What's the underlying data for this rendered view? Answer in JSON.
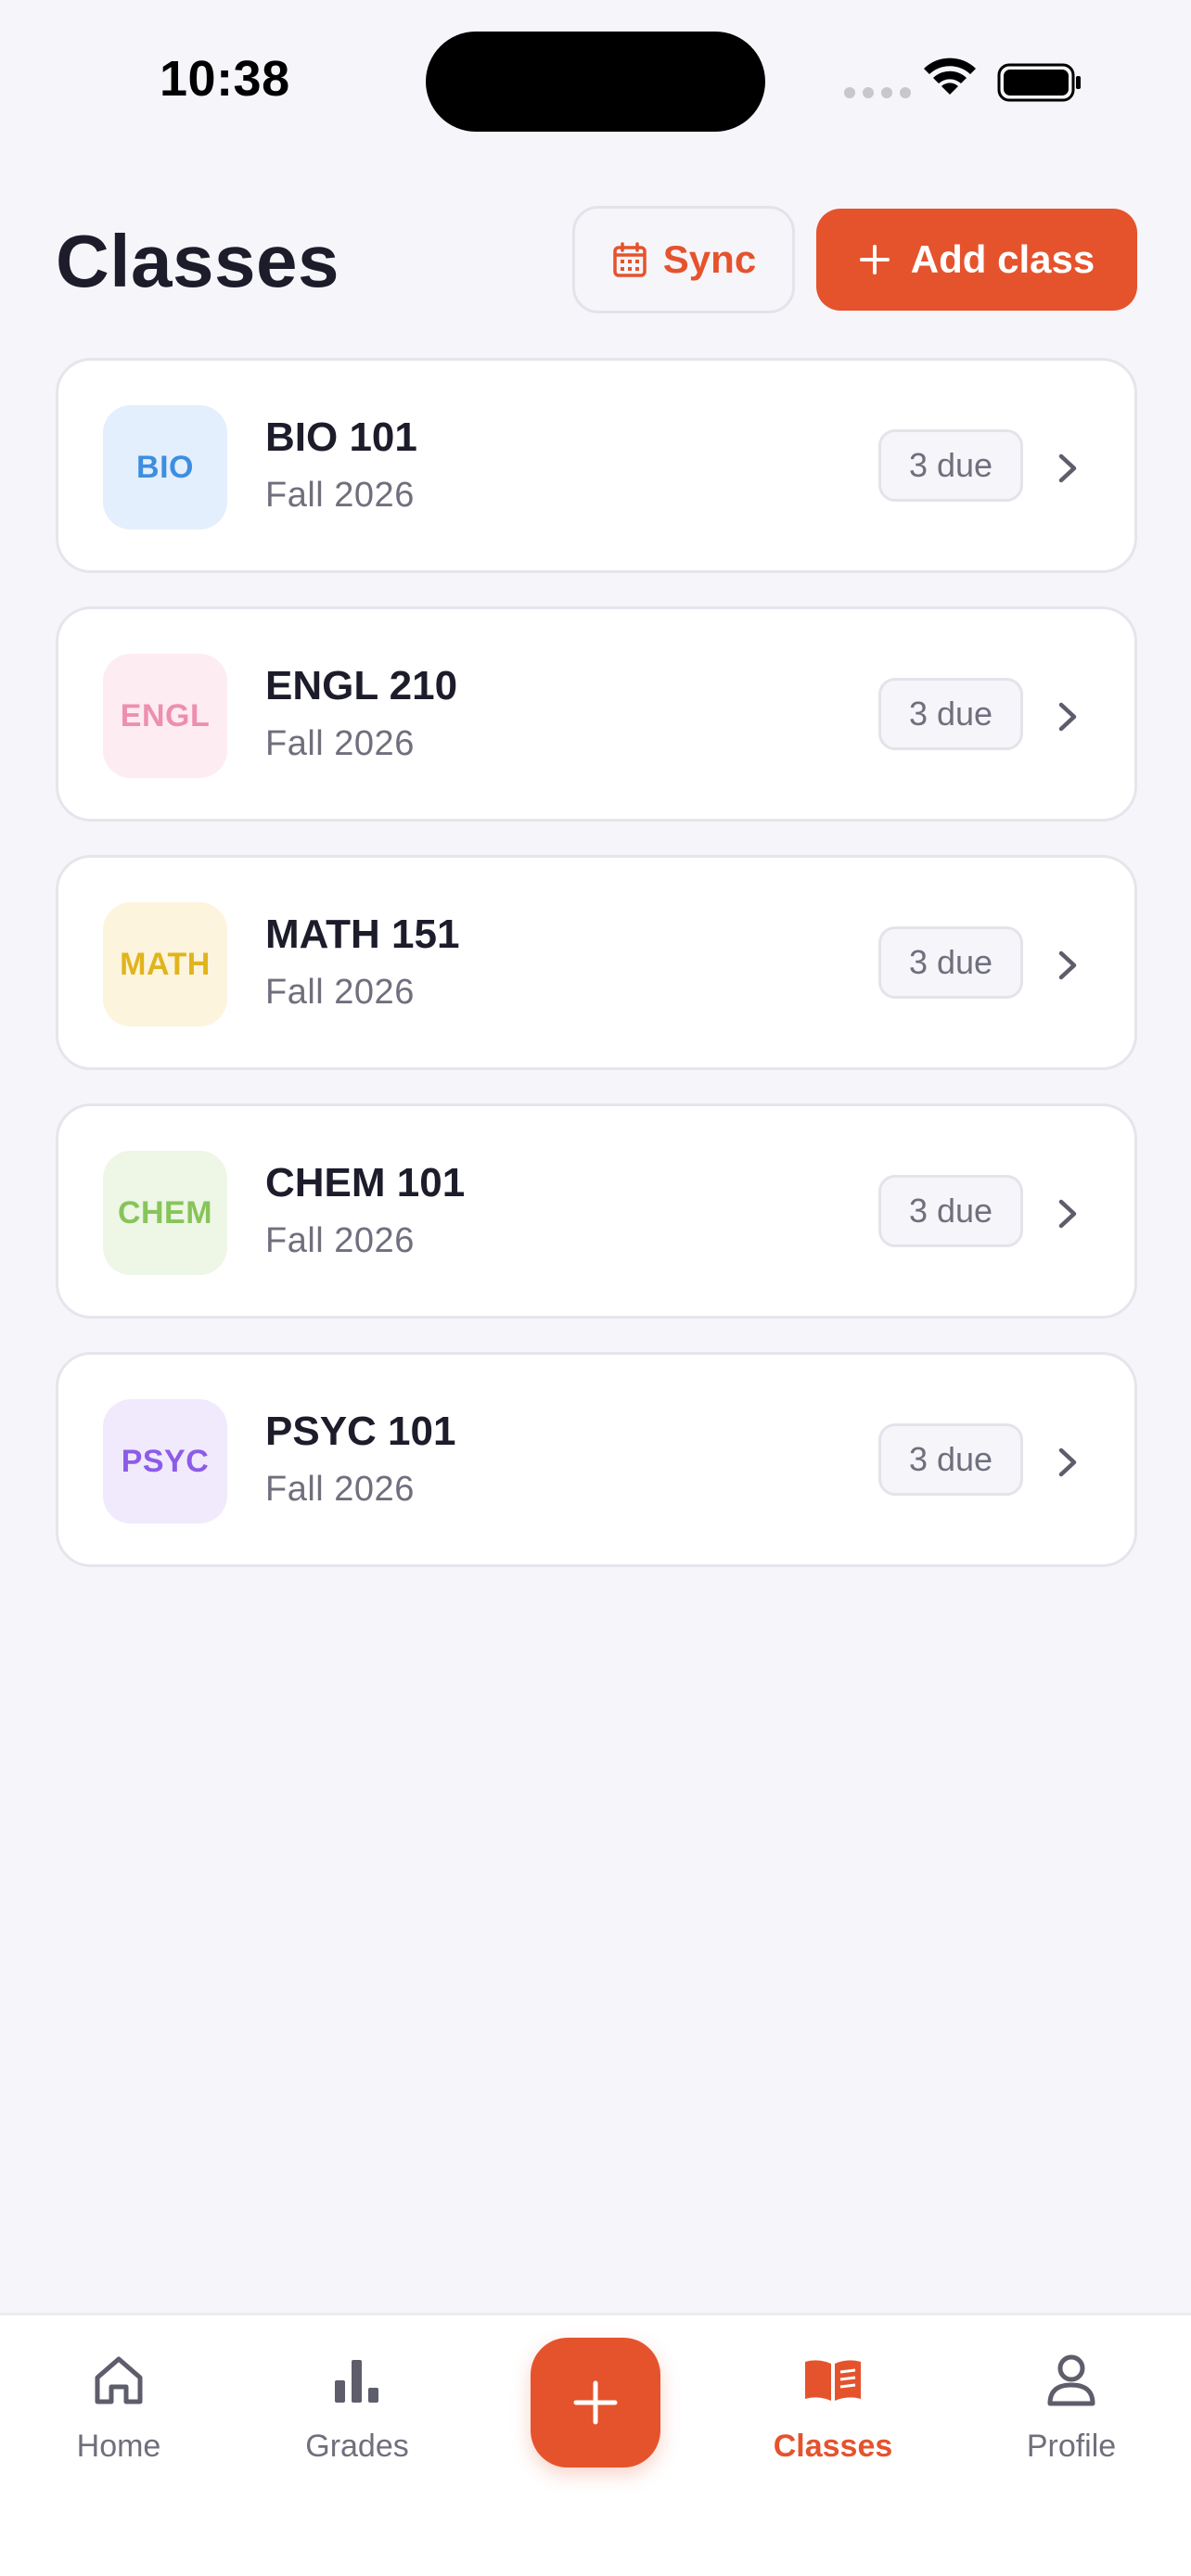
{
  "status_bar": {
    "time": "10:38"
  },
  "header": {
    "title": "Classes",
    "sync_label": "Sync",
    "add_label": "Add class"
  },
  "colors": {
    "accent": "#e5532d",
    "background": "#f6f5fa"
  },
  "classes": [
    {
      "badge": "BIO",
      "name": "BIO 101",
      "term": "Fall 2026",
      "due": "3 due",
      "badge_bg": "#e3effc",
      "badge_fg": "#3d8ee0"
    },
    {
      "badge": "ENGL",
      "name": "ENGL 210",
      "term": "Fall 2026",
      "due": "3 due",
      "badge_bg": "#fdecf1",
      "badge_fg": "#ee8fae"
    },
    {
      "badge": "MATH",
      "name": "MATH 151",
      "term": "Fall 2026",
      "due": "3 due",
      "badge_bg": "#fdf4dd",
      "badge_fg": "#e0b41c"
    },
    {
      "badge": "CHEM",
      "name": "CHEM 101",
      "term": "Fall 2026",
      "due": "3 due",
      "badge_bg": "#eef6e6",
      "badge_fg": "#87c45a"
    },
    {
      "badge": "PSYC",
      "name": "PSYC 101",
      "term": "Fall 2026",
      "due": "3 due",
      "badge_bg": "#f0eafc",
      "badge_fg": "#8c5ce8"
    }
  ],
  "tab_bar": {
    "home": "Home",
    "grades": "Grades",
    "classes": "Classes",
    "profile": "Profile",
    "active": "classes"
  }
}
